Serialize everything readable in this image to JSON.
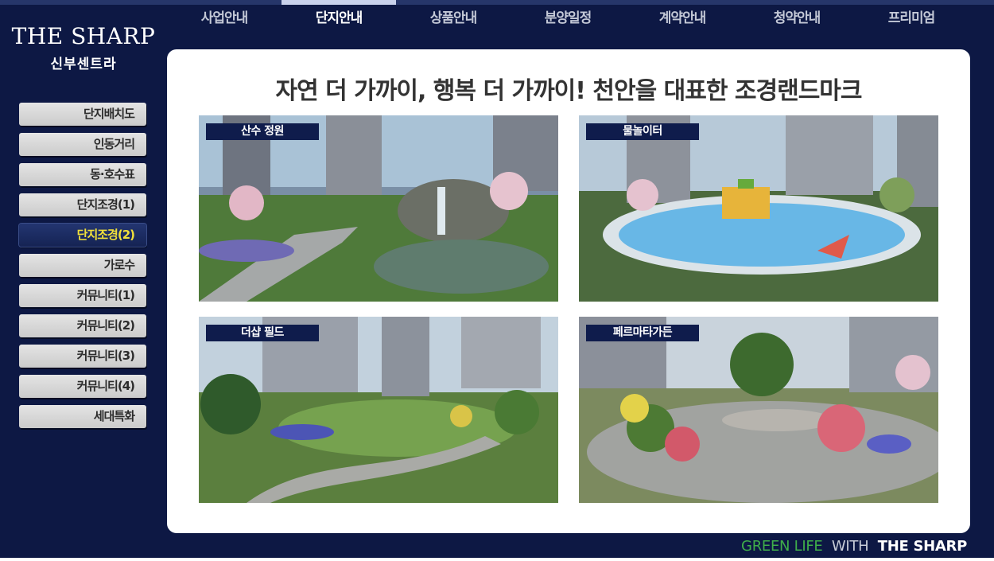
{
  "brand": {
    "name": "THE SHARP",
    "sub": "신부센트라"
  },
  "topnav": [
    "사업안내",
    "단지안내",
    "상품안내",
    "분양일정",
    "계약안내",
    "청약안내",
    "프리미엄"
  ],
  "topnav_active": "단지안내",
  "sidebar": [
    "단지배치도",
    "인동거리",
    "동·호수표",
    "단지조경(1)",
    "단지조경(2)",
    "가로수",
    "커뮤니티(1)",
    "커뮤니티(2)",
    "커뮤니티(3)",
    "커뮤니티(4)",
    "세대특화"
  ],
  "sidebar_active": "단지조경(2)",
  "main": {
    "headline": "자연 더 가까이, 행복 더 가까이! 천안을 대표한 조경랜드마크",
    "photos": [
      {
        "label": "산수 정원"
      },
      {
        "label": "물놀이터"
      },
      {
        "label": "더샵 필드"
      },
      {
        "label": "페르마타가든"
      }
    ]
  },
  "footer": {
    "green": "GREEN LIFE",
    "with": "WITH",
    "brand": "THE SHARP"
  },
  "colors": {
    "navy": "#0d1844",
    "tag": "#0f1c4c",
    "active_text": "#f1e03a",
    "green": "#3fae4a"
  }
}
